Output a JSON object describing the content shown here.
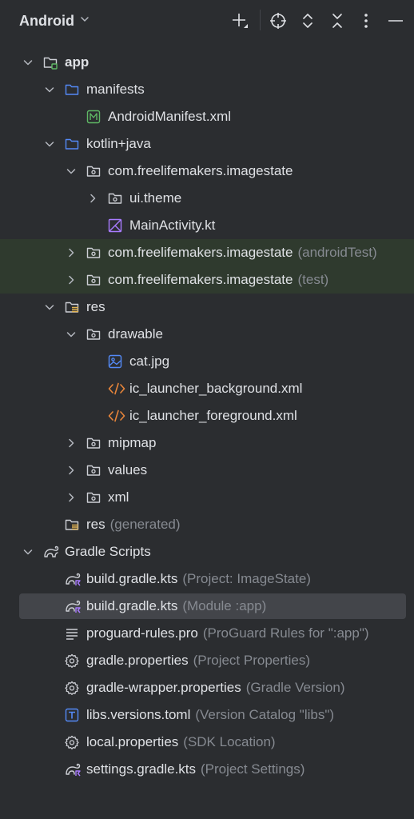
{
  "header": {
    "view_title": "Android"
  },
  "tree": [
    {
      "label": "app",
      "suffix": "",
      "depth": 0,
      "arrow": "down",
      "icon": "module-folder-icon",
      "bold": true
    },
    {
      "label": "manifests",
      "suffix": "",
      "depth": 1,
      "arrow": "down",
      "icon": "folder-icon"
    },
    {
      "label": "AndroidManifest.xml",
      "suffix": "",
      "depth": 2,
      "arrow": "",
      "icon": "manifest-file-icon"
    },
    {
      "label": "kotlin+java",
      "suffix": "",
      "depth": 1,
      "arrow": "down",
      "icon": "folder-icon"
    },
    {
      "label": "com.freelifemakers.imagestate",
      "suffix": "",
      "depth": 2,
      "arrow": "down",
      "icon": "package-icon"
    },
    {
      "label": "ui.theme",
      "suffix": "",
      "depth": 3,
      "arrow": "right",
      "icon": "package-icon"
    },
    {
      "label": "MainActivity.kt",
      "suffix": "",
      "depth": 3,
      "arrow": "",
      "icon": "kotlin-file-icon"
    },
    {
      "label": "com.freelifemakers.imagestate",
      "suffix": "(androidTest)",
      "depth": 2,
      "arrow": "right",
      "icon": "package-icon",
      "highlight": true
    },
    {
      "label": "com.freelifemakers.imagestate",
      "suffix": "(test)",
      "depth": 2,
      "arrow": "right",
      "icon": "package-icon",
      "highlight": true
    },
    {
      "label": "res",
      "suffix": "",
      "depth": 1,
      "arrow": "down",
      "icon": "resource-folder-icon"
    },
    {
      "label": "drawable",
      "suffix": "",
      "depth": 2,
      "arrow": "down",
      "icon": "package-icon"
    },
    {
      "label": "cat.jpg",
      "suffix": "",
      "depth": 3,
      "arrow": "",
      "icon": "image-file-icon"
    },
    {
      "label": "ic_launcher_background.xml",
      "suffix": "",
      "depth": 3,
      "arrow": "",
      "icon": "xml-file-icon"
    },
    {
      "label": "ic_launcher_foreground.xml",
      "suffix": "",
      "depth": 3,
      "arrow": "",
      "icon": "xml-file-icon"
    },
    {
      "label": "mipmap",
      "suffix": "",
      "depth": 2,
      "arrow": "right",
      "icon": "package-icon"
    },
    {
      "label": "values",
      "suffix": "",
      "depth": 2,
      "arrow": "right",
      "icon": "package-icon"
    },
    {
      "label": "xml",
      "suffix": "",
      "depth": 2,
      "arrow": "right",
      "icon": "package-icon"
    },
    {
      "label": "res",
      "suffix": "(generated)",
      "depth": 1,
      "arrow": "",
      "icon": "resource-folder-icon"
    },
    {
      "label": "Gradle Scripts",
      "suffix": "",
      "depth": 0,
      "arrow": "down",
      "icon": "gradle-icon"
    },
    {
      "label": "build.gradle.kts",
      "suffix": "(Project: ImageState)",
      "depth": 1,
      "arrow": "",
      "icon": "gradle-kts-icon"
    },
    {
      "label": "build.gradle.kts",
      "suffix": "(Module :app)",
      "depth": 1,
      "arrow": "",
      "icon": "gradle-kts-icon",
      "selected": true
    },
    {
      "label": "proguard-rules.pro",
      "suffix": "(ProGuard Rules for \":app\")",
      "depth": 1,
      "arrow": "",
      "icon": "text-lines-icon"
    },
    {
      "label": "gradle.properties",
      "suffix": "(Project Properties)",
      "depth": 1,
      "arrow": "",
      "icon": "gear-icon"
    },
    {
      "label": "gradle-wrapper.properties",
      "suffix": "(Gradle Version)",
      "depth": 1,
      "arrow": "",
      "icon": "gear-icon"
    },
    {
      "label": "libs.versions.toml",
      "suffix": "(Version Catalog \"libs\")",
      "depth": 1,
      "arrow": "",
      "icon": "toml-file-icon"
    },
    {
      "label": "local.properties",
      "suffix": "(SDK Location)",
      "depth": 1,
      "arrow": "",
      "icon": "gear-icon"
    },
    {
      "label": "settings.gradle.kts",
      "suffix": "(Project Settings)",
      "depth": 1,
      "arrow": "",
      "icon": "gradle-kts-icon"
    }
  ]
}
